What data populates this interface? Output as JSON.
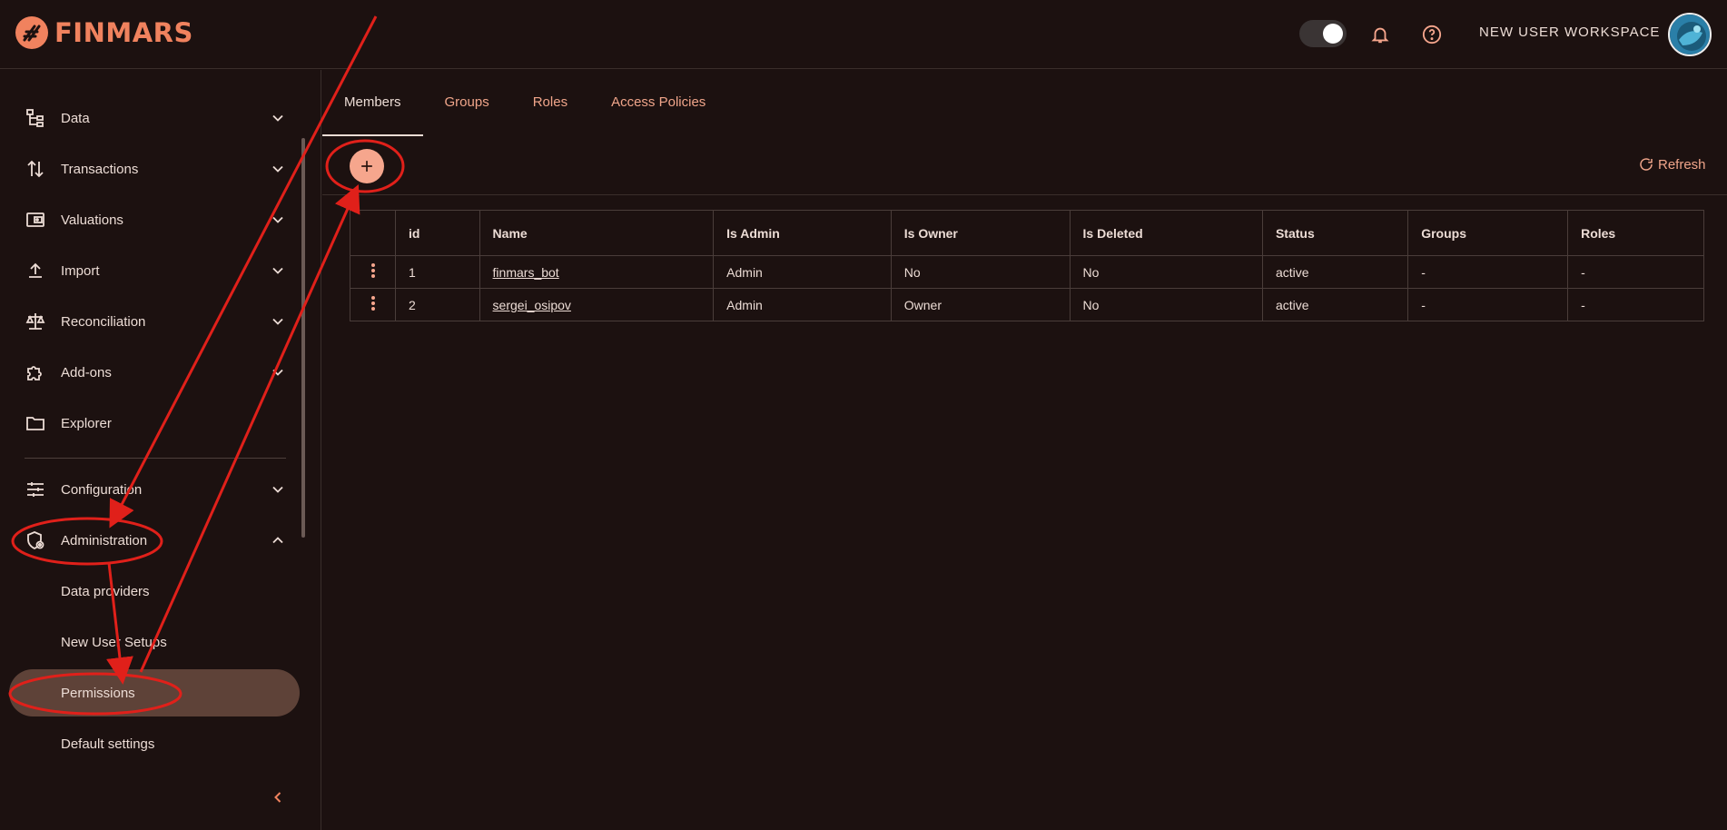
{
  "header": {
    "logo_text": "FINMARS",
    "workspace_label": "NEW USER WORKSPACE",
    "brand_color": "#f0825e"
  },
  "sidebar": {
    "items": [
      {
        "label": "Data",
        "icon": "data-tree-icon",
        "expandable": true
      },
      {
        "label": "Transactions",
        "icon": "transfer-arrows-icon",
        "expandable": true
      },
      {
        "label": "Valuations",
        "icon": "wallet-icon",
        "expandable": true
      },
      {
        "label": "Import",
        "icon": "upload-icon",
        "expandable": true
      },
      {
        "label": "Reconciliation",
        "icon": "scale-icon",
        "expandable": true
      },
      {
        "label": "Add-ons",
        "icon": "puzzle-icon",
        "expandable": true
      },
      {
        "label": "Explorer",
        "icon": "folder-icon",
        "expandable": false
      },
      {
        "label": "Configuration",
        "icon": "sliders-icon",
        "expandable": true
      },
      {
        "label": "Administration",
        "icon": "shield-gear-icon",
        "expandable": true,
        "expanded": true
      }
    ],
    "sub_items": [
      {
        "label": "Data providers"
      },
      {
        "label": "New User Setups"
      },
      {
        "label": "Permissions",
        "active": true
      },
      {
        "label": "Default settings"
      }
    ]
  },
  "main": {
    "tabs": [
      {
        "label": "Members",
        "active": true
      },
      {
        "label": "Groups"
      },
      {
        "label": "Roles"
      },
      {
        "label": "Access Policies"
      }
    ],
    "refresh_label": "Refresh",
    "table": {
      "columns": [
        "",
        "id",
        "Name",
        "Is Admin",
        "Is Owner",
        "Is Deleted",
        "Status",
        "Groups",
        "Roles"
      ],
      "rows": [
        {
          "id": "1",
          "name": "finmars_bot",
          "is_admin": "Admin",
          "is_owner": "No",
          "is_deleted": "No",
          "status": "active",
          "groups": "-",
          "roles": "-"
        },
        {
          "id": "2",
          "name": "sergei_osipov",
          "is_admin": "Admin",
          "is_owner": "Owner",
          "is_deleted": "No",
          "status": "active",
          "groups": "-",
          "roles": "-"
        }
      ]
    }
  },
  "colors": {
    "background": "#1c1110",
    "accent": "#f6a68d",
    "active_item": "#5e4238",
    "annotation": "#e0201a"
  }
}
